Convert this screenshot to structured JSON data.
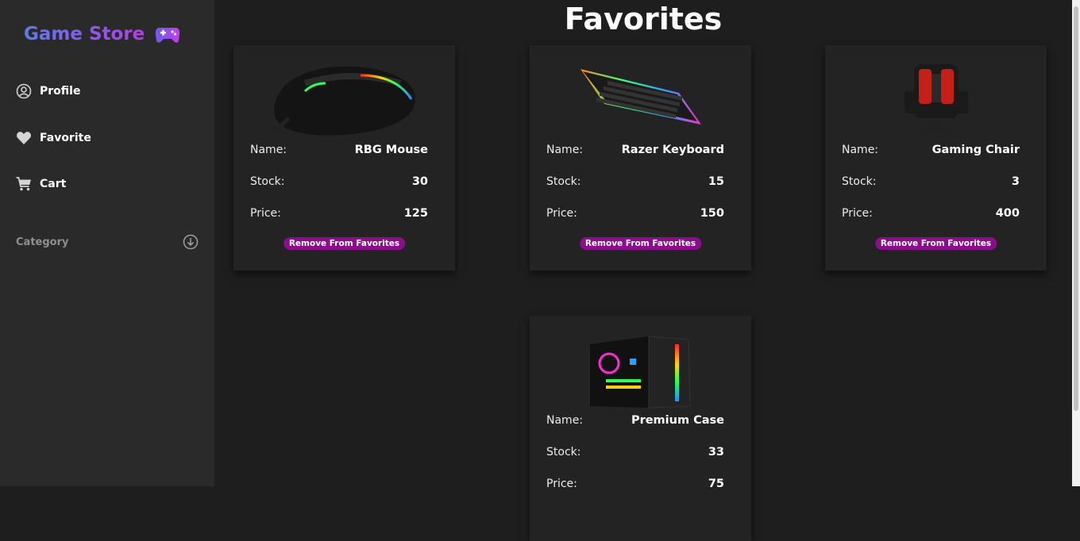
{
  "app": {
    "title": "Game Store",
    "brand_gradient": [
      "#5e7bf0",
      "#b33ee6"
    ]
  },
  "sidebar": {
    "items": [
      {
        "label": "Profile",
        "icon": "user-circle-icon"
      },
      {
        "label": "Favorite",
        "icon": "heart-icon"
      },
      {
        "label": "Cart",
        "icon": "cart-icon"
      }
    ],
    "category": {
      "label": "Category",
      "icon": "arrow-down-circle-icon"
    }
  },
  "main": {
    "title": "Favorites",
    "field_labels": {
      "name": "Name:",
      "stock": "Stock:",
      "price": "Price:"
    },
    "remove_label": "Remove From Favorites",
    "accent_color": "#8b0d8b",
    "products": [
      {
        "name": "RBG Mouse",
        "stock": "30",
        "price": "125",
        "image": "gaming-mouse"
      },
      {
        "name": "Razer Keyboard",
        "stock": "15",
        "price": "150",
        "image": "rgb-keyboard"
      },
      {
        "name": "Gaming Chair",
        "stock": "3",
        "price": "400",
        "image": "gaming-chair"
      },
      {
        "name": "Premium Case",
        "stock": "33",
        "price": "75",
        "image": "pc-case"
      }
    ]
  }
}
